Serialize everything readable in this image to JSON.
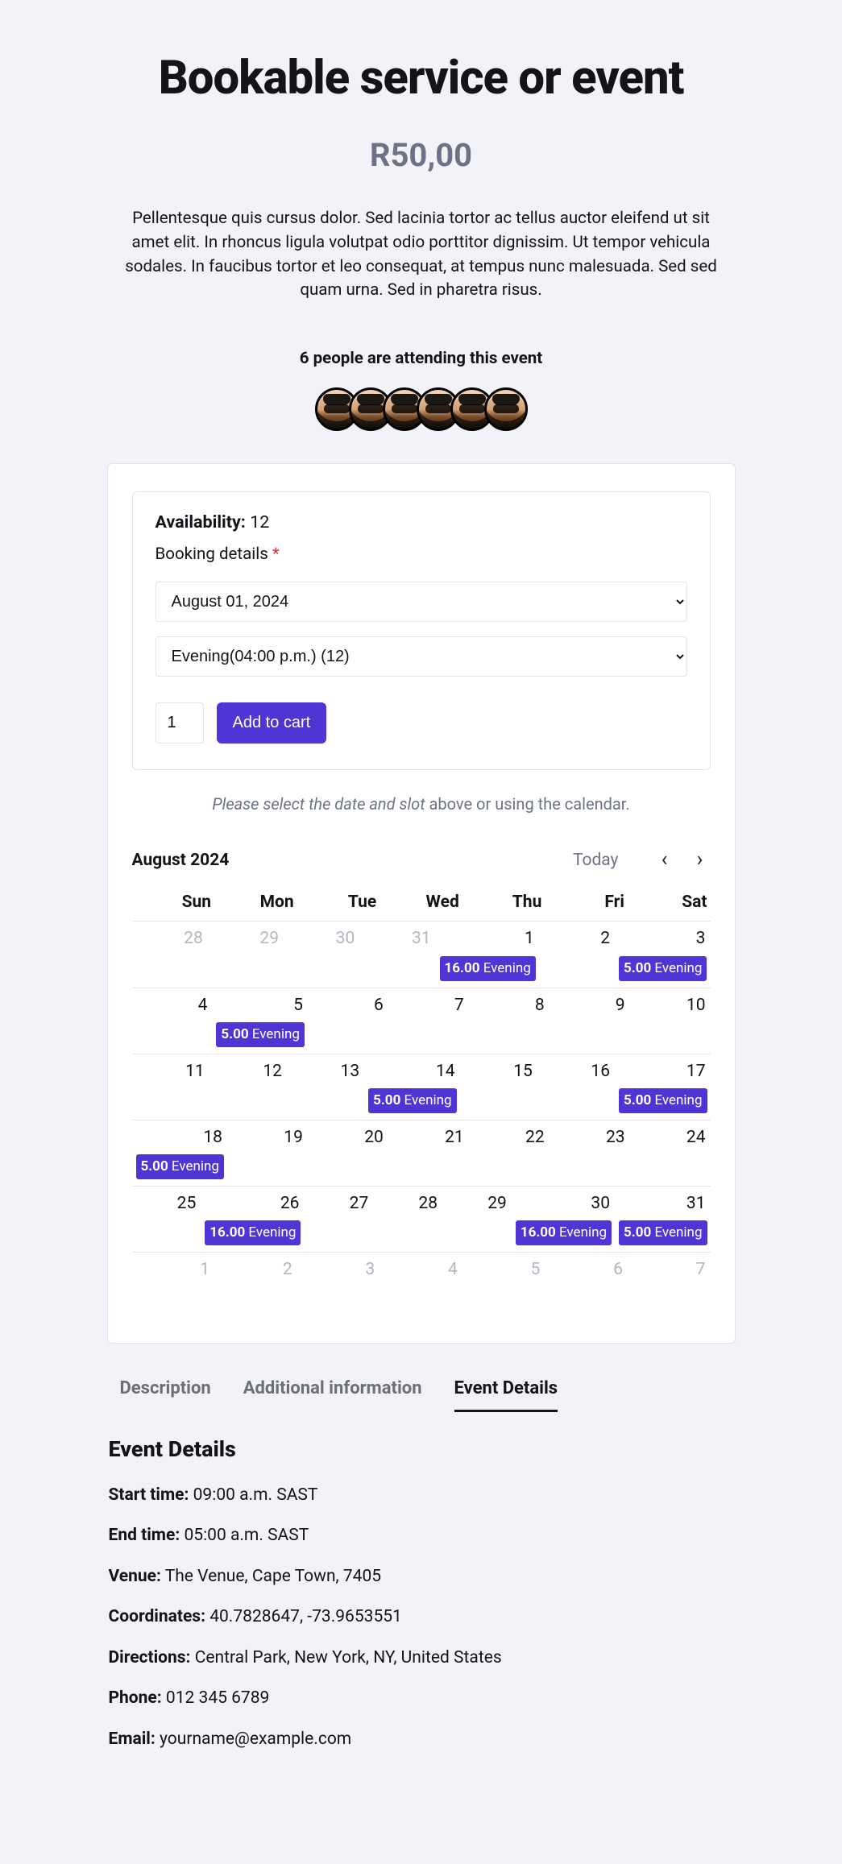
{
  "title": "Bookable service or event",
  "price": "R50,00",
  "description": "Pellentesque quis cursus dolor. Sed lacinia tortor ac tellus auctor eleifend ut sit amet elit. In rhoncus ligula volutpat odio porttitor dignissim. Ut tempor vehicula sodales. In faucibus tortor et leo consequat, at tempus nunc malesuada. Sed sed quam urna. Sed in pharetra risus.",
  "attendance_line": "6 people are attending this event",
  "avatar_count": 6,
  "booking": {
    "availability_label": "Availability:",
    "availability_value": "12",
    "details_label": "Booking details",
    "date_selected": "August 01, 2024",
    "slot_selected": "Evening(04:00 p.m.) (12)",
    "quantity": "1",
    "add_to_cart": "Add to cart"
  },
  "helper": {
    "italic": "Please select the date and slot",
    "rest": " above or using the calendar."
  },
  "calendar": {
    "month": "August 2024",
    "today": "Today",
    "dow": [
      "Sun",
      "Mon",
      "Tue",
      "Wed",
      "Thu",
      "Fri",
      "Sat"
    ],
    "weeks": [
      [
        {
          "n": "28",
          "muted": true
        },
        {
          "n": "29",
          "muted": true
        },
        {
          "n": "30",
          "muted": true
        },
        {
          "n": "31",
          "muted": true
        },
        {
          "n": "1",
          "events": [
            {
              "count": "16.00",
              "label": "Evening"
            }
          ]
        },
        {
          "n": "2"
        },
        {
          "n": "3",
          "events": [
            {
              "count": "5.00",
              "label": "Evening"
            }
          ]
        }
      ],
      [
        {
          "n": "4"
        },
        {
          "n": "5",
          "events": [
            {
              "count": "5.00",
              "label": "Evening"
            }
          ]
        },
        {
          "n": "6"
        },
        {
          "n": "7"
        },
        {
          "n": "8"
        },
        {
          "n": "9"
        },
        {
          "n": "10"
        }
      ],
      [
        {
          "n": "11"
        },
        {
          "n": "12"
        },
        {
          "n": "13"
        },
        {
          "n": "14",
          "events": [
            {
              "count": "5.00",
              "label": "Evening"
            }
          ]
        },
        {
          "n": "15"
        },
        {
          "n": "16"
        },
        {
          "n": "17",
          "events": [
            {
              "count": "5.00",
              "label": "Evening"
            }
          ]
        }
      ],
      [
        {
          "n": "18",
          "events": [
            {
              "count": "5.00",
              "label": "Evening"
            }
          ]
        },
        {
          "n": "19"
        },
        {
          "n": "20"
        },
        {
          "n": "21"
        },
        {
          "n": "22"
        },
        {
          "n": "23"
        },
        {
          "n": "24"
        }
      ],
      [
        {
          "n": "25"
        },
        {
          "n": "26",
          "events": [
            {
              "count": "16.00",
              "label": "Evening"
            }
          ]
        },
        {
          "n": "27"
        },
        {
          "n": "28"
        },
        {
          "n": "29"
        },
        {
          "n": "30",
          "events": [
            {
              "count": "16.00",
              "label": "Evening"
            }
          ]
        },
        {
          "n": "31",
          "events": [
            {
              "count": "5.00",
              "label": "Evening"
            }
          ]
        }
      ],
      [
        {
          "n": "1",
          "muted": true
        },
        {
          "n": "2",
          "muted": true
        },
        {
          "n": "3",
          "muted": true
        },
        {
          "n": "4",
          "muted": true
        },
        {
          "n": "5",
          "muted": true
        },
        {
          "n": "6",
          "muted": true
        },
        {
          "n": "7",
          "muted": true
        }
      ]
    ]
  },
  "tabs": {
    "description": "Description",
    "additional": "Additional information",
    "event_details": "Event Details"
  },
  "details": {
    "heading": "Event Details",
    "start_label": "Start time:",
    "start_value": " 09:00 a.m. SAST",
    "end_label": "End time:",
    "end_value": " 05:00 a.m. SAST",
    "venue_label": "Venue:",
    "venue_value": " The Venue, Cape Town, 7405",
    "coord_label": "Coordinates:",
    "coord_value": " 40.7828647, -73.9653551",
    "dir_label": "Directions:",
    "dir_value": " Central Park, New York, NY, United States",
    "phone_label": "Phone:",
    "phone_value": " 012 345 6789",
    "email_label": "Email:",
    "email_value": " yourname@example.com"
  }
}
